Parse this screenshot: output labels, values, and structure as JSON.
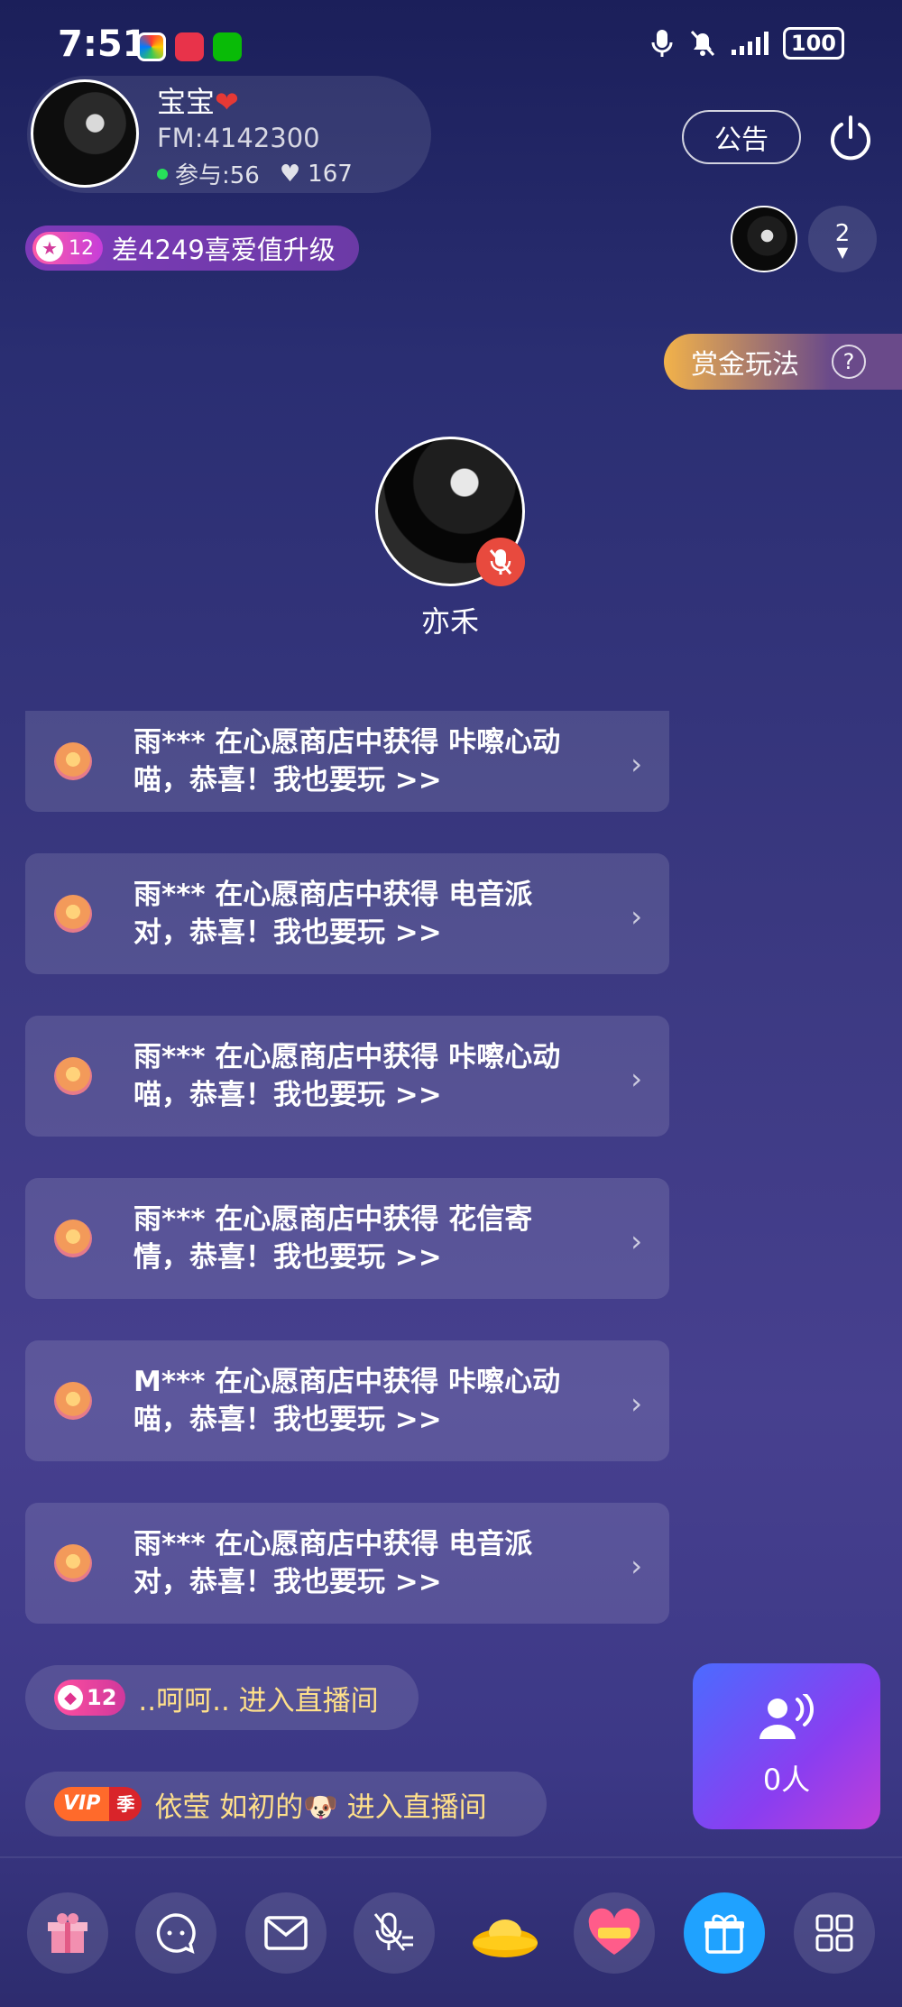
{
  "status_bar": {
    "time": "7:51",
    "battery": "100",
    "icons": [
      "app-icon-1",
      "app-icon-2",
      "wechat-icon",
      "mic-icon",
      "bell-off-icon",
      "signal-icon",
      "battery-icon"
    ]
  },
  "room": {
    "name": "宝宝",
    "name_emoji": "❤️",
    "fm": "FM:4142300",
    "participants": "参与:56",
    "likes": "167",
    "notice_label": "公告"
  },
  "level": {
    "badge": "12",
    "text": "差4249喜爱值升级"
  },
  "viewers": {
    "count": "2"
  },
  "bounty": {
    "label": "赏金玩法",
    "help": "?"
  },
  "host": {
    "name": "亦禾"
  },
  "messages": [
    {
      "text": "雨*** 在心愿商店中获得 咔嚓心动喵，恭喜！我也要玩 >>"
    },
    {
      "text": "雨*** 在心愿商店中获得 电音派对，恭喜！我也要玩 >>"
    },
    {
      "text": "雨*** 在心愿商店中获得 咔嚓心动喵，恭喜！我也要玩 >>"
    },
    {
      "text": "雨*** 在心愿商店中获得 花信寄情，恭喜！我也要玩 >>"
    },
    {
      "text": "M*** 在心愿商店中获得 咔嚓心动喵，恭喜！我也要玩 >>"
    },
    {
      "text": "雨*** 在心愿商店中获得 电音派对，恭喜！我也要玩 >>"
    }
  ],
  "entries": [
    {
      "badge": "12",
      "text": "..呵呵.. 进入直播间"
    },
    {
      "vip": "VIP",
      "season": "季",
      "text": "依莹 如初的🐶 进入直播间"
    }
  ],
  "online": {
    "count": "0人"
  },
  "bottom_bar": [
    "gift-box-icon",
    "chat-icon",
    "mail-icon",
    "mic-off-icon",
    "gold-ingot-icon",
    "heart-icon",
    "gift-icon",
    "grid-icon"
  ],
  "colors": {
    "accent": "#1fa2ff",
    "entry_text": "#ffe08a",
    "mute": "#e84a3e"
  }
}
